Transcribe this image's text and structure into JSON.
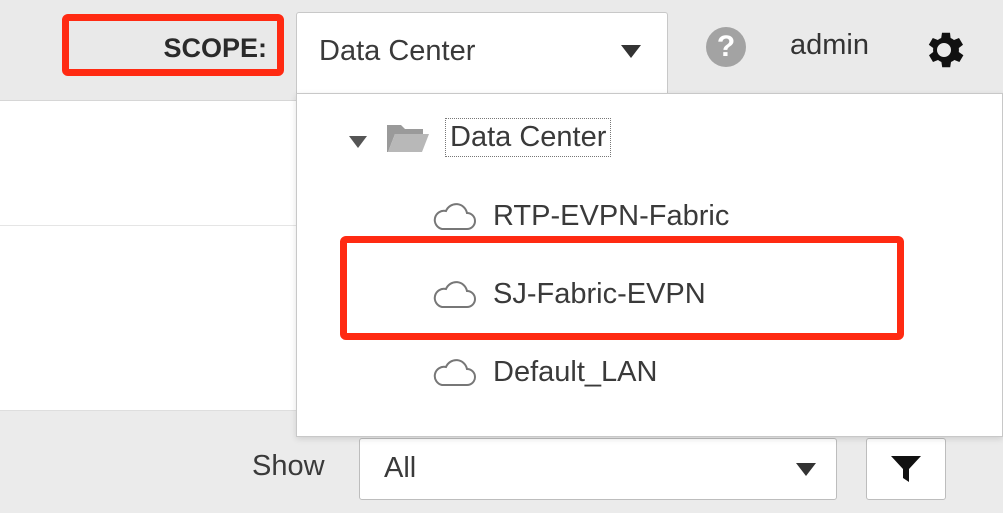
{
  "header": {
    "scope_label": "SCOPE:",
    "scope_value": "Data Center",
    "user": "admin",
    "help_icon": "question-circle-icon",
    "settings_icon": "gear-icon"
  },
  "dropdown": {
    "root": {
      "label": "Data Center",
      "icon": "folder-open-icon",
      "expanded": true
    },
    "items": [
      {
        "label": "RTP-EVPN-Fabric",
        "icon": "cloud-icon"
      },
      {
        "label": "SJ-Fabric-EVPN",
        "icon": "cloud-icon"
      },
      {
        "label": "Default_LAN",
        "icon": "cloud-icon"
      }
    ]
  },
  "filter": {
    "show_label": "Show",
    "show_value": "All",
    "filter_icon": "funnel-icon"
  },
  "colors": {
    "highlight": "#ff2a12",
    "header_bg": "#eaeaea"
  }
}
